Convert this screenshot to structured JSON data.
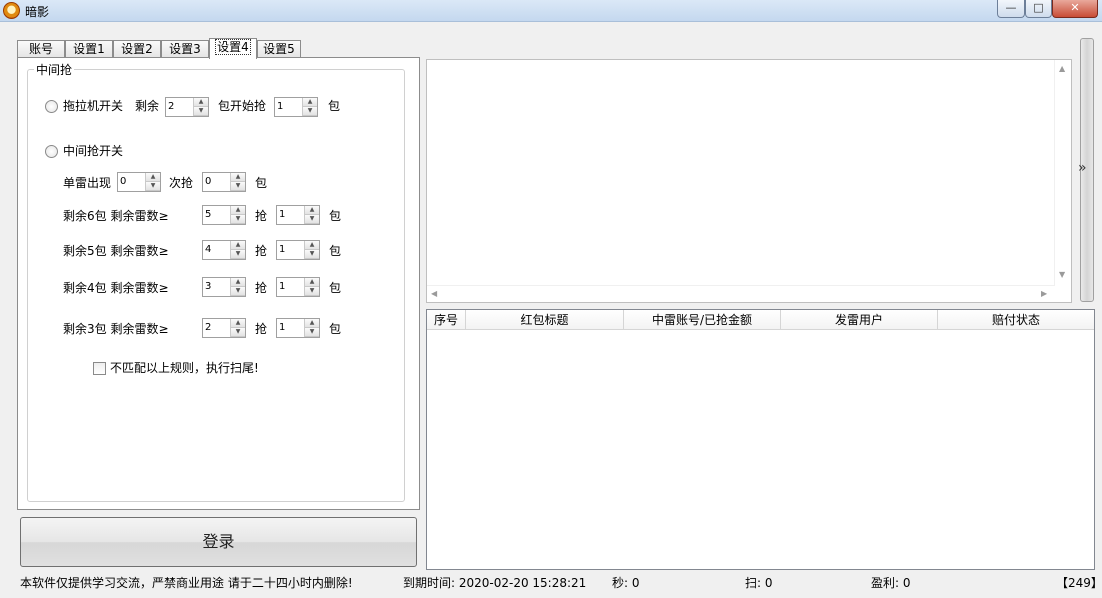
{
  "window": {
    "title": "暗影"
  },
  "tabs": [
    {
      "label": "账号"
    },
    {
      "label": "设置1"
    },
    {
      "label": "设置2"
    },
    {
      "label": "设置3"
    },
    {
      "label": "设置4"
    },
    {
      "label": "设置5"
    }
  ],
  "group": {
    "title": "中间抢",
    "tractor": {
      "label": "拖拉机开关",
      "remain_label": "剩余",
      "remain_value": "2",
      "start_label": "包开始抢",
      "start_value": "1",
      "unit": "包"
    },
    "middle": {
      "label": "中间抢开关"
    },
    "single_mine": {
      "label": "单雷出现",
      "value1": "0",
      "mid_label": "次抢",
      "value2": "0",
      "unit": "包"
    },
    "rules": [
      {
        "label": "剩余6包 剩余雷数≥",
        "mines": "5",
        "grab_label": "抢",
        "grab": "1",
        "unit": "包"
      },
      {
        "label": "剩余5包 剩余雷数≥",
        "mines": "4",
        "grab_label": "抢",
        "grab": "1",
        "unit": "包"
      },
      {
        "label": "剩余4包 剩余雷数≥",
        "mines": "3",
        "grab_label": "抢",
        "grab": "1",
        "unit": "包"
      },
      {
        "label": "剩余3包 剩余雷数≥",
        "mines": "2",
        "grab_label": "抢",
        "grab": "1",
        "unit": "包"
      }
    ],
    "sweep": {
      "label": "不匹配以上规则，执行扫尾!"
    }
  },
  "login_button": "登录",
  "list": {
    "columns": [
      "序号",
      "红包标题",
      "中雷账号/已抢金额",
      "发雷用户",
      "赔付状态"
    ]
  },
  "status": {
    "disclaimer": "本软件仅提供学习交流，严禁商业用途 请于二十四小时内删除!",
    "expire": "到期时间: 2020-02-20 15:28:21",
    "seconds": "秒: 0",
    "scan": "扫: 0",
    "profit": "盈利: 0",
    "counter": "【249】"
  },
  "expand_glyph": "»",
  "icons": [
    "app-icon",
    "minimize-icon",
    "maximize-icon",
    "close-icon",
    "expand-panel-icon"
  ]
}
